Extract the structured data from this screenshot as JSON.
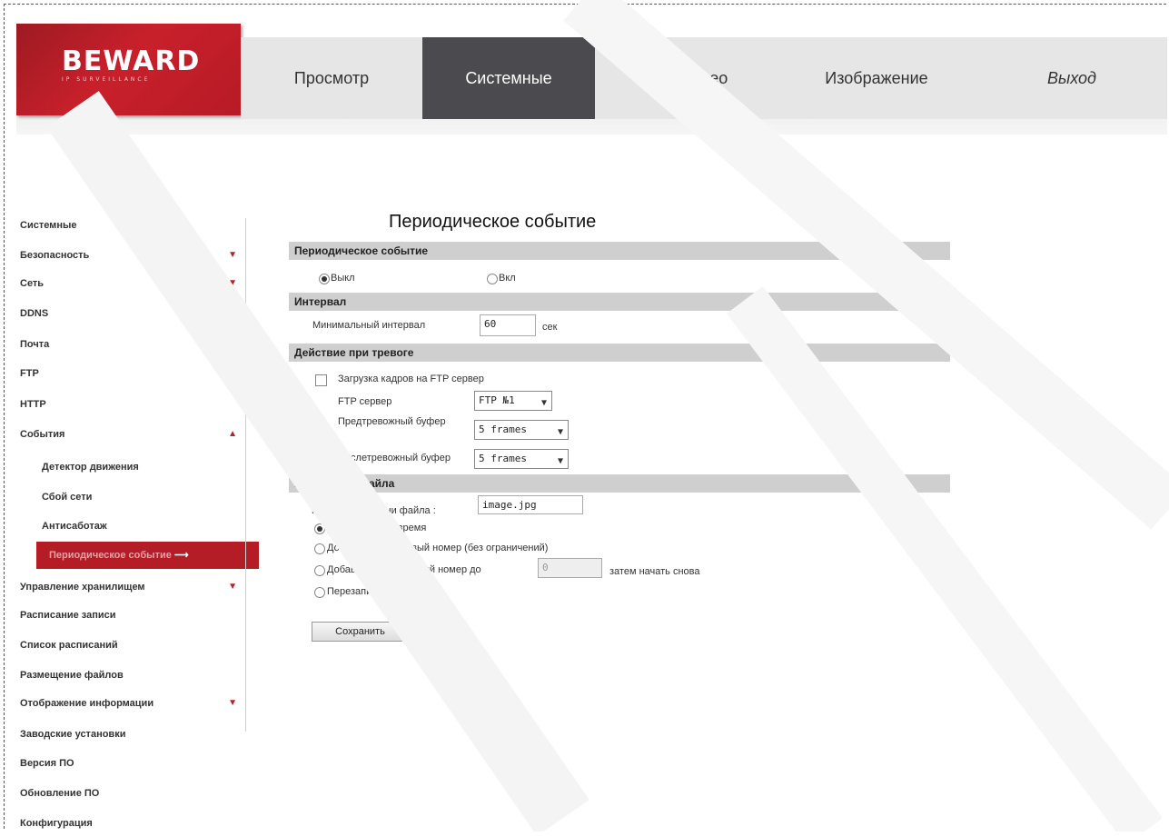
{
  "brand": {
    "logo_text": "BEWARD",
    "logo_sub": "IP SURVEILLANCE"
  },
  "nav": {
    "items": [
      {
        "label": "Просмотр"
      },
      {
        "label": "Системные"
      },
      {
        "label": "Видео"
      },
      {
        "label": "Изображение"
      },
      {
        "label": "Выход"
      }
    ],
    "active": "Системные"
  },
  "sidebar": {
    "items": [
      {
        "label": "Системные"
      },
      {
        "label": "Безопасность"
      },
      {
        "label": "Сеть"
      },
      {
        "label": "DDNS"
      },
      {
        "label": "Почта"
      },
      {
        "label": "FTP"
      },
      {
        "label": "HTTP"
      },
      {
        "label": "События"
      },
      {
        "label": "Детектор движения"
      },
      {
        "label": "Сбой сети"
      },
      {
        "label": "Антисаботаж"
      },
      {
        "label": "Периодическое событие"
      },
      {
        "label": "Управление хранилищем"
      },
      {
        "label": "Расписание записи"
      },
      {
        "label": "Список расписаний"
      },
      {
        "label": "Размещение файлов"
      },
      {
        "label": "Отображение информации"
      },
      {
        "label": "Заводские установки"
      },
      {
        "label": "Версия ПО"
      },
      {
        "label": "Обновление ПО"
      },
      {
        "label": "Конфигурация"
      }
    ],
    "arrow_down": "▼",
    "arrow_up": "▲",
    "active_arrow": "⟶"
  },
  "page": {
    "title": "Периодическое событие",
    "section_event": "Периодическое событие",
    "radio_off": "Выкл",
    "radio_on": "Вкл",
    "section_interval": "Интервал",
    "min_interval_label": "Минимальный интервал",
    "min_interval_value": "60",
    "interval_unit": "сек",
    "section_action": "Действие при тревоге",
    "ftp_upload_label": "Загрузка кадров на FTP сервер",
    "ftp_server_label": "FTP сервер",
    "ftp_server_value": "FTP №1",
    "pre_buffer_label": "Предтревожный буфер",
    "pre_buffer_value": "5  frames",
    "post_buffer_label": "Послетревожный буфер",
    "post_buffer_value": "5  frames",
    "section_file": "Параметры файла",
    "file_name_label": "Параметры имени файла :",
    "file_name_value": "image.jpg",
    "opt_datetime": "Добавить дату/время",
    "opt_seq_unlimited": "Добавить порядковый номер (без ограничений)",
    "opt_seq_upto": "Добавлять порядковый номер до",
    "opt_seq_upto_value": "0",
    "opt_seq_upto_suffix": "затем начать снова",
    "opt_overwrite": "Перезаписывать файл",
    "save_label": "Сохранить",
    "chevron": "⌄"
  }
}
